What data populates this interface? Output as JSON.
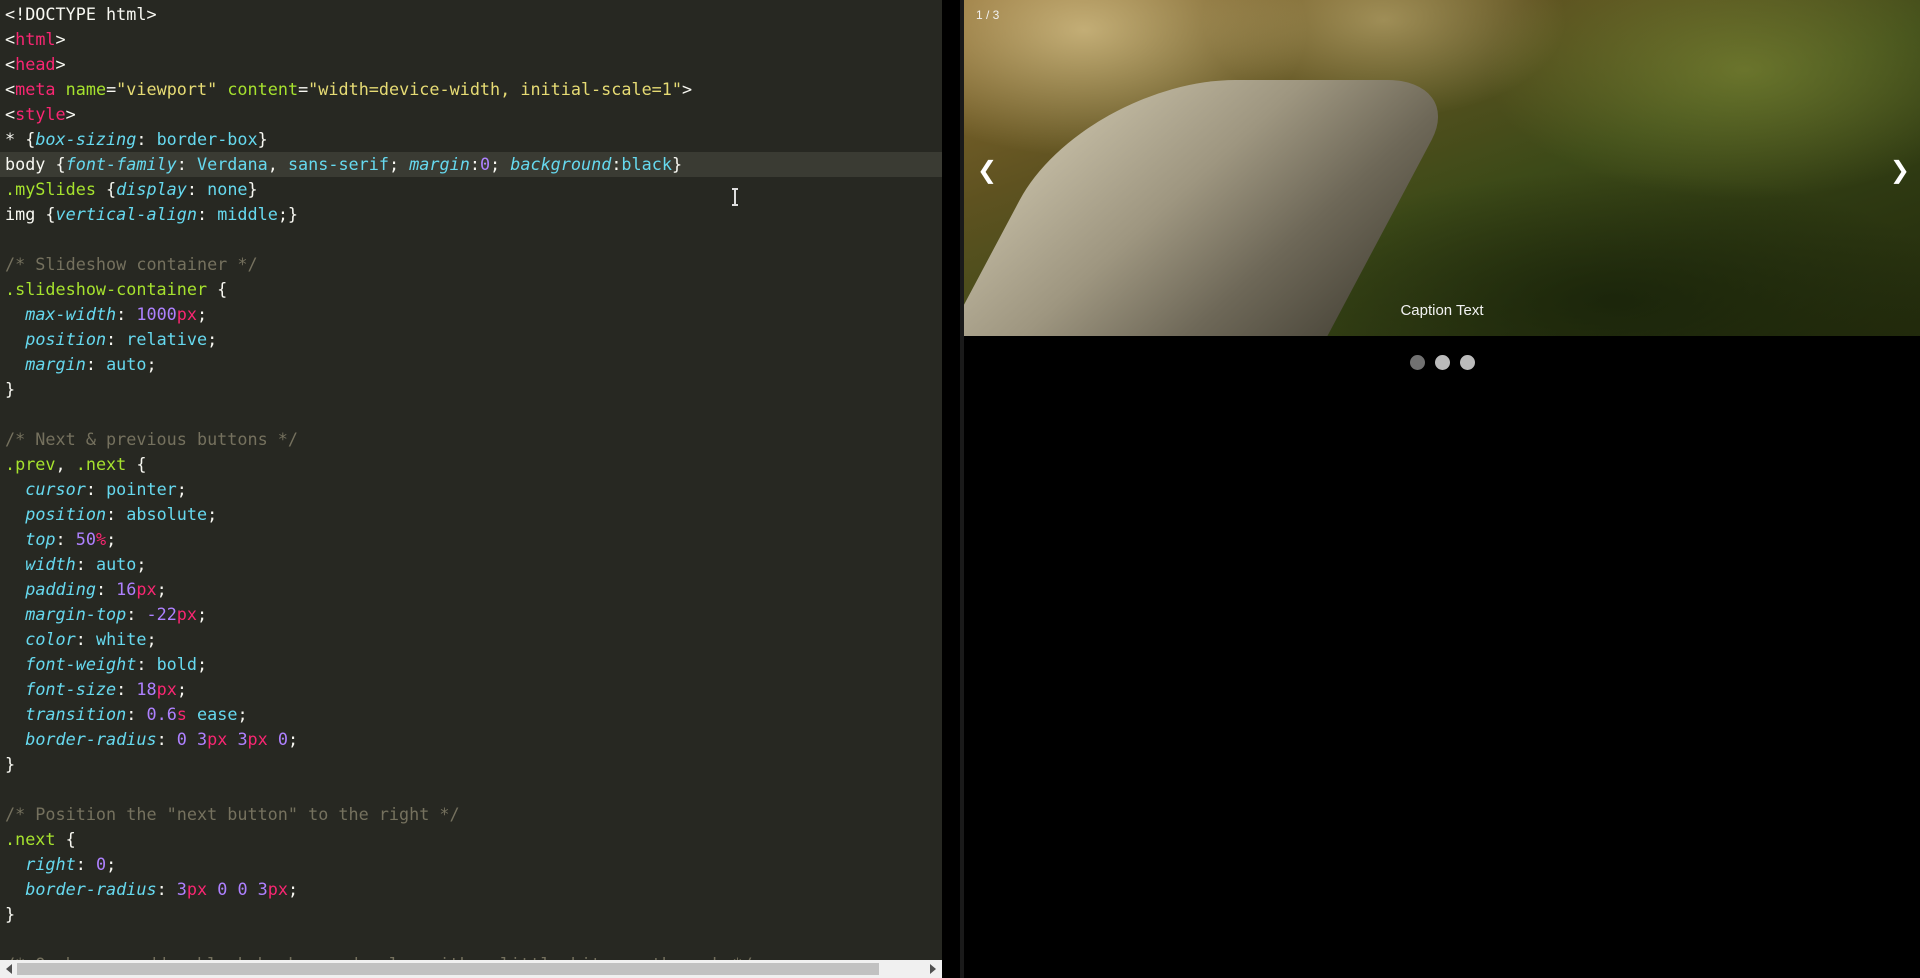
{
  "editor": {
    "lines": [
      {
        "tokens": [
          [
            "t-plain",
            "<!DOCTYPE html>"
          ]
        ]
      },
      {
        "tokens": [
          [
            "t-punc",
            "<"
          ],
          [
            "t-tag",
            "html"
          ],
          [
            "t-punc",
            ">"
          ]
        ]
      },
      {
        "tokens": [
          [
            "t-punc",
            "<"
          ],
          [
            "t-tag",
            "head"
          ],
          [
            "t-punc",
            ">"
          ]
        ]
      },
      {
        "tokens": [
          [
            "t-punc",
            "<"
          ],
          [
            "t-tag",
            "meta"
          ],
          [
            "t-plain",
            " "
          ],
          [
            "t-attr",
            "name"
          ],
          [
            "t-punc",
            "="
          ],
          [
            "t-str",
            "\"viewport\""
          ],
          [
            "t-plain",
            " "
          ],
          [
            "t-attr",
            "content"
          ],
          [
            "t-punc",
            "="
          ],
          [
            "t-str",
            "\"width=device-width, initial-scale=1\""
          ],
          [
            "t-punc",
            ">"
          ]
        ]
      },
      {
        "tokens": [
          [
            "t-punc",
            "<"
          ],
          [
            "t-tag",
            "style"
          ],
          [
            "t-punc",
            ">"
          ]
        ]
      },
      {
        "tokens": [
          [
            "t-plain",
            "* {"
          ],
          [
            "t-prop",
            "box-sizing"
          ],
          [
            "t-plain",
            ": "
          ],
          [
            "t-val",
            "border-box"
          ],
          [
            "t-plain",
            "}"
          ]
        ]
      },
      {
        "active": true,
        "tokens": [
          [
            "t-plain",
            "body {"
          ],
          [
            "t-prop",
            "font-family"
          ],
          [
            "t-plain",
            ": "
          ],
          [
            "t-val",
            "Verdana"
          ],
          [
            "t-plain",
            ", "
          ],
          [
            "t-val",
            "sans-serif"
          ],
          [
            "t-plain",
            "; "
          ],
          [
            "t-prop",
            "margin"
          ],
          [
            "t-plain",
            ":"
          ],
          [
            "t-num",
            "0"
          ],
          [
            "t-plain",
            "; "
          ],
          [
            "t-prop",
            "background"
          ],
          [
            "t-plain",
            ":"
          ],
          [
            "t-val",
            "black"
          ],
          [
            "t-plain",
            "}"
          ]
        ]
      },
      {
        "tokens": [
          [
            "t-sel",
            ".mySlides"
          ],
          [
            "t-plain",
            " {"
          ],
          [
            "t-prop",
            "display"
          ],
          [
            "t-plain",
            ": "
          ],
          [
            "t-val",
            "none"
          ],
          [
            "t-plain",
            "}"
          ]
        ]
      },
      {
        "tokens": [
          [
            "t-plain",
            "img {"
          ],
          [
            "t-prop",
            "vertical-align"
          ],
          [
            "t-plain",
            ": "
          ],
          [
            "t-val",
            "middle"
          ],
          [
            "t-plain",
            ";}"
          ]
        ]
      },
      {
        "tokens": []
      },
      {
        "tokens": [
          [
            "t-com",
            "/* Slideshow container */"
          ]
        ]
      },
      {
        "tokens": [
          [
            "t-sel",
            ".slideshow-container"
          ],
          [
            "t-plain",
            " {"
          ]
        ]
      },
      {
        "tokens": [
          [
            "t-plain",
            "  "
          ],
          [
            "t-prop",
            "max-width"
          ],
          [
            "t-plain",
            ": "
          ],
          [
            "t-num",
            "1000"
          ],
          [
            "t-unit",
            "px"
          ],
          [
            "t-plain",
            ";"
          ]
        ]
      },
      {
        "tokens": [
          [
            "t-plain",
            "  "
          ],
          [
            "t-prop",
            "position"
          ],
          [
            "t-plain",
            ": "
          ],
          [
            "t-val",
            "relative"
          ],
          [
            "t-plain",
            ";"
          ]
        ]
      },
      {
        "tokens": [
          [
            "t-plain",
            "  "
          ],
          [
            "t-prop",
            "margin"
          ],
          [
            "t-plain",
            ": "
          ],
          [
            "t-val",
            "auto"
          ],
          [
            "t-plain",
            ";"
          ]
        ]
      },
      {
        "tokens": [
          [
            "t-plain",
            "}"
          ]
        ]
      },
      {
        "tokens": []
      },
      {
        "tokens": [
          [
            "t-com",
            "/* Next & previous buttons */"
          ]
        ]
      },
      {
        "tokens": [
          [
            "t-sel",
            ".prev"
          ],
          [
            "t-plain",
            ", "
          ],
          [
            "t-sel",
            ".next"
          ],
          [
            "t-plain",
            " {"
          ]
        ]
      },
      {
        "tokens": [
          [
            "t-plain",
            "  "
          ],
          [
            "t-prop",
            "cursor"
          ],
          [
            "t-plain",
            ": "
          ],
          [
            "t-val",
            "pointer"
          ],
          [
            "t-plain",
            ";"
          ]
        ]
      },
      {
        "tokens": [
          [
            "t-plain",
            "  "
          ],
          [
            "t-prop",
            "position"
          ],
          [
            "t-plain",
            ": "
          ],
          [
            "t-val",
            "absolute"
          ],
          [
            "t-plain",
            ";"
          ]
        ]
      },
      {
        "tokens": [
          [
            "t-plain",
            "  "
          ],
          [
            "t-prop",
            "top"
          ],
          [
            "t-plain",
            ": "
          ],
          [
            "t-num",
            "50"
          ],
          [
            "t-unit",
            "%"
          ],
          [
            "t-plain",
            ";"
          ]
        ]
      },
      {
        "tokens": [
          [
            "t-plain",
            "  "
          ],
          [
            "t-prop",
            "width"
          ],
          [
            "t-plain",
            ": "
          ],
          [
            "t-val",
            "auto"
          ],
          [
            "t-plain",
            ";"
          ]
        ]
      },
      {
        "tokens": [
          [
            "t-plain",
            "  "
          ],
          [
            "t-prop",
            "padding"
          ],
          [
            "t-plain",
            ": "
          ],
          [
            "t-num",
            "16"
          ],
          [
            "t-unit",
            "px"
          ],
          [
            "t-plain",
            ";"
          ]
        ]
      },
      {
        "tokens": [
          [
            "t-plain",
            "  "
          ],
          [
            "t-prop",
            "margin-top"
          ],
          [
            "t-plain",
            ": "
          ],
          [
            "t-num",
            "-22"
          ],
          [
            "t-unit",
            "px"
          ],
          [
            "t-plain",
            ";"
          ]
        ]
      },
      {
        "tokens": [
          [
            "t-plain",
            "  "
          ],
          [
            "t-prop",
            "color"
          ],
          [
            "t-plain",
            ": "
          ],
          [
            "t-val",
            "white"
          ],
          [
            "t-plain",
            ";"
          ]
        ]
      },
      {
        "tokens": [
          [
            "t-plain",
            "  "
          ],
          [
            "t-prop",
            "font-weight"
          ],
          [
            "t-plain",
            ": "
          ],
          [
            "t-val",
            "bold"
          ],
          [
            "t-plain",
            ";"
          ]
        ]
      },
      {
        "tokens": [
          [
            "t-plain",
            "  "
          ],
          [
            "t-prop",
            "font-size"
          ],
          [
            "t-plain",
            ": "
          ],
          [
            "t-num",
            "18"
          ],
          [
            "t-unit",
            "px"
          ],
          [
            "t-plain",
            ";"
          ]
        ]
      },
      {
        "tokens": [
          [
            "t-plain",
            "  "
          ],
          [
            "t-prop",
            "transition"
          ],
          [
            "t-plain",
            ": "
          ],
          [
            "t-num",
            "0.6"
          ],
          [
            "t-unit",
            "s"
          ],
          [
            "t-plain",
            " "
          ],
          [
            "t-val",
            "ease"
          ],
          [
            "t-plain",
            ";"
          ]
        ]
      },
      {
        "tokens": [
          [
            "t-plain",
            "  "
          ],
          [
            "t-prop",
            "border-radius"
          ],
          [
            "t-plain",
            ": "
          ],
          [
            "t-num",
            "0"
          ],
          [
            "t-plain",
            " "
          ],
          [
            "t-num",
            "3"
          ],
          [
            "t-unit",
            "px"
          ],
          [
            "t-plain",
            " "
          ],
          [
            "t-num",
            "3"
          ],
          [
            "t-unit",
            "px"
          ],
          [
            "t-plain",
            " "
          ],
          [
            "t-num",
            "0"
          ],
          [
            "t-plain",
            ";"
          ]
        ]
      },
      {
        "tokens": [
          [
            "t-plain",
            "}"
          ]
        ]
      },
      {
        "tokens": []
      },
      {
        "tokens": [
          [
            "t-com",
            "/* Position the \"next button\" to the right */"
          ]
        ]
      },
      {
        "tokens": [
          [
            "t-sel",
            ".next"
          ],
          [
            "t-plain",
            " {"
          ]
        ]
      },
      {
        "tokens": [
          [
            "t-plain",
            "  "
          ],
          [
            "t-prop",
            "right"
          ],
          [
            "t-plain",
            ": "
          ],
          [
            "t-num",
            "0"
          ],
          [
            "t-plain",
            ";"
          ]
        ]
      },
      {
        "tokens": [
          [
            "t-plain",
            "  "
          ],
          [
            "t-prop",
            "border-radius"
          ],
          [
            "t-plain",
            ": "
          ],
          [
            "t-num",
            "3"
          ],
          [
            "t-unit",
            "px"
          ],
          [
            "t-plain",
            " "
          ],
          [
            "t-num",
            "0"
          ],
          [
            "t-plain",
            " "
          ],
          [
            "t-num",
            "0"
          ],
          [
            "t-plain",
            " "
          ],
          [
            "t-num",
            "3"
          ],
          [
            "t-unit",
            "px"
          ],
          [
            "t-plain",
            ";"
          ]
        ]
      },
      {
        "tokens": [
          [
            "t-plain",
            "}"
          ]
        ]
      },
      {
        "tokens": []
      },
      {
        "tokens": [
          [
            "t-com",
            "/* On hover, add a black background color with a little bit see-through */"
          ]
        ]
      }
    ]
  },
  "result": {
    "counter": "1 / 3",
    "prev_label": "❮",
    "next_label": "❯",
    "caption": "Caption Text",
    "dots": [
      true,
      false,
      false
    ]
  }
}
